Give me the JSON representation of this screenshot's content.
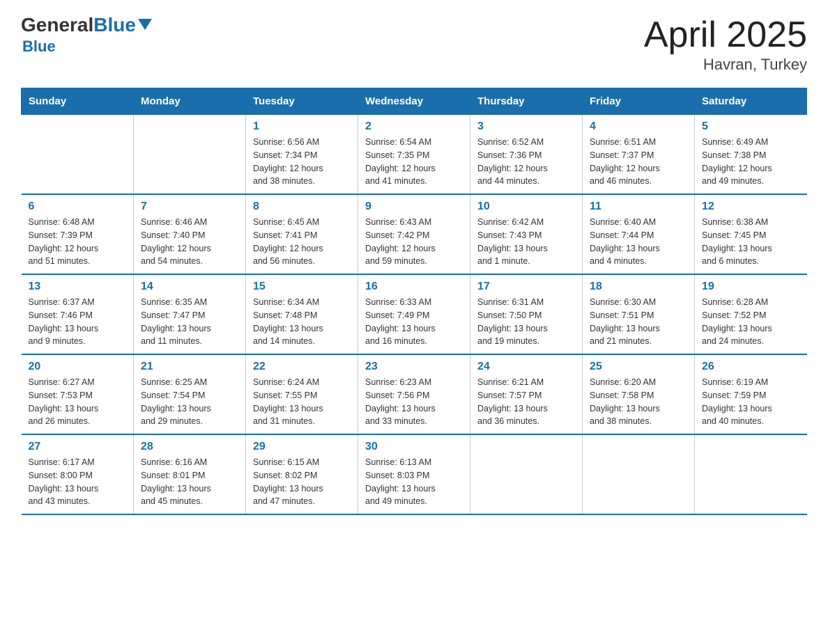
{
  "header": {
    "logo_general": "General",
    "logo_blue": "Blue",
    "month_year": "April 2025",
    "location": "Havran, Turkey"
  },
  "weekdays": [
    "Sunday",
    "Monday",
    "Tuesday",
    "Wednesday",
    "Thursday",
    "Friday",
    "Saturday"
  ],
  "weeks": [
    [
      {
        "day": "",
        "info": ""
      },
      {
        "day": "",
        "info": ""
      },
      {
        "day": "1",
        "info": "Sunrise: 6:56 AM\nSunset: 7:34 PM\nDaylight: 12 hours\nand 38 minutes."
      },
      {
        "day": "2",
        "info": "Sunrise: 6:54 AM\nSunset: 7:35 PM\nDaylight: 12 hours\nand 41 minutes."
      },
      {
        "day": "3",
        "info": "Sunrise: 6:52 AM\nSunset: 7:36 PM\nDaylight: 12 hours\nand 44 minutes."
      },
      {
        "day": "4",
        "info": "Sunrise: 6:51 AM\nSunset: 7:37 PM\nDaylight: 12 hours\nand 46 minutes."
      },
      {
        "day": "5",
        "info": "Sunrise: 6:49 AM\nSunset: 7:38 PM\nDaylight: 12 hours\nand 49 minutes."
      }
    ],
    [
      {
        "day": "6",
        "info": "Sunrise: 6:48 AM\nSunset: 7:39 PM\nDaylight: 12 hours\nand 51 minutes."
      },
      {
        "day": "7",
        "info": "Sunrise: 6:46 AM\nSunset: 7:40 PM\nDaylight: 12 hours\nand 54 minutes."
      },
      {
        "day": "8",
        "info": "Sunrise: 6:45 AM\nSunset: 7:41 PM\nDaylight: 12 hours\nand 56 minutes."
      },
      {
        "day": "9",
        "info": "Sunrise: 6:43 AM\nSunset: 7:42 PM\nDaylight: 12 hours\nand 59 minutes."
      },
      {
        "day": "10",
        "info": "Sunrise: 6:42 AM\nSunset: 7:43 PM\nDaylight: 13 hours\nand 1 minute."
      },
      {
        "day": "11",
        "info": "Sunrise: 6:40 AM\nSunset: 7:44 PM\nDaylight: 13 hours\nand 4 minutes."
      },
      {
        "day": "12",
        "info": "Sunrise: 6:38 AM\nSunset: 7:45 PM\nDaylight: 13 hours\nand 6 minutes."
      }
    ],
    [
      {
        "day": "13",
        "info": "Sunrise: 6:37 AM\nSunset: 7:46 PM\nDaylight: 13 hours\nand 9 minutes."
      },
      {
        "day": "14",
        "info": "Sunrise: 6:35 AM\nSunset: 7:47 PM\nDaylight: 13 hours\nand 11 minutes."
      },
      {
        "day": "15",
        "info": "Sunrise: 6:34 AM\nSunset: 7:48 PM\nDaylight: 13 hours\nand 14 minutes."
      },
      {
        "day": "16",
        "info": "Sunrise: 6:33 AM\nSunset: 7:49 PM\nDaylight: 13 hours\nand 16 minutes."
      },
      {
        "day": "17",
        "info": "Sunrise: 6:31 AM\nSunset: 7:50 PM\nDaylight: 13 hours\nand 19 minutes."
      },
      {
        "day": "18",
        "info": "Sunrise: 6:30 AM\nSunset: 7:51 PM\nDaylight: 13 hours\nand 21 minutes."
      },
      {
        "day": "19",
        "info": "Sunrise: 6:28 AM\nSunset: 7:52 PM\nDaylight: 13 hours\nand 24 minutes."
      }
    ],
    [
      {
        "day": "20",
        "info": "Sunrise: 6:27 AM\nSunset: 7:53 PM\nDaylight: 13 hours\nand 26 minutes."
      },
      {
        "day": "21",
        "info": "Sunrise: 6:25 AM\nSunset: 7:54 PM\nDaylight: 13 hours\nand 29 minutes."
      },
      {
        "day": "22",
        "info": "Sunrise: 6:24 AM\nSunset: 7:55 PM\nDaylight: 13 hours\nand 31 minutes."
      },
      {
        "day": "23",
        "info": "Sunrise: 6:23 AM\nSunset: 7:56 PM\nDaylight: 13 hours\nand 33 minutes."
      },
      {
        "day": "24",
        "info": "Sunrise: 6:21 AM\nSunset: 7:57 PM\nDaylight: 13 hours\nand 36 minutes."
      },
      {
        "day": "25",
        "info": "Sunrise: 6:20 AM\nSunset: 7:58 PM\nDaylight: 13 hours\nand 38 minutes."
      },
      {
        "day": "26",
        "info": "Sunrise: 6:19 AM\nSunset: 7:59 PM\nDaylight: 13 hours\nand 40 minutes."
      }
    ],
    [
      {
        "day": "27",
        "info": "Sunrise: 6:17 AM\nSunset: 8:00 PM\nDaylight: 13 hours\nand 43 minutes."
      },
      {
        "day": "28",
        "info": "Sunrise: 6:16 AM\nSunset: 8:01 PM\nDaylight: 13 hours\nand 45 minutes."
      },
      {
        "day": "29",
        "info": "Sunrise: 6:15 AM\nSunset: 8:02 PM\nDaylight: 13 hours\nand 47 minutes."
      },
      {
        "day": "30",
        "info": "Sunrise: 6:13 AM\nSunset: 8:03 PM\nDaylight: 13 hours\nand 49 minutes."
      },
      {
        "day": "",
        "info": ""
      },
      {
        "day": "",
        "info": ""
      },
      {
        "day": "",
        "info": ""
      }
    ]
  ]
}
